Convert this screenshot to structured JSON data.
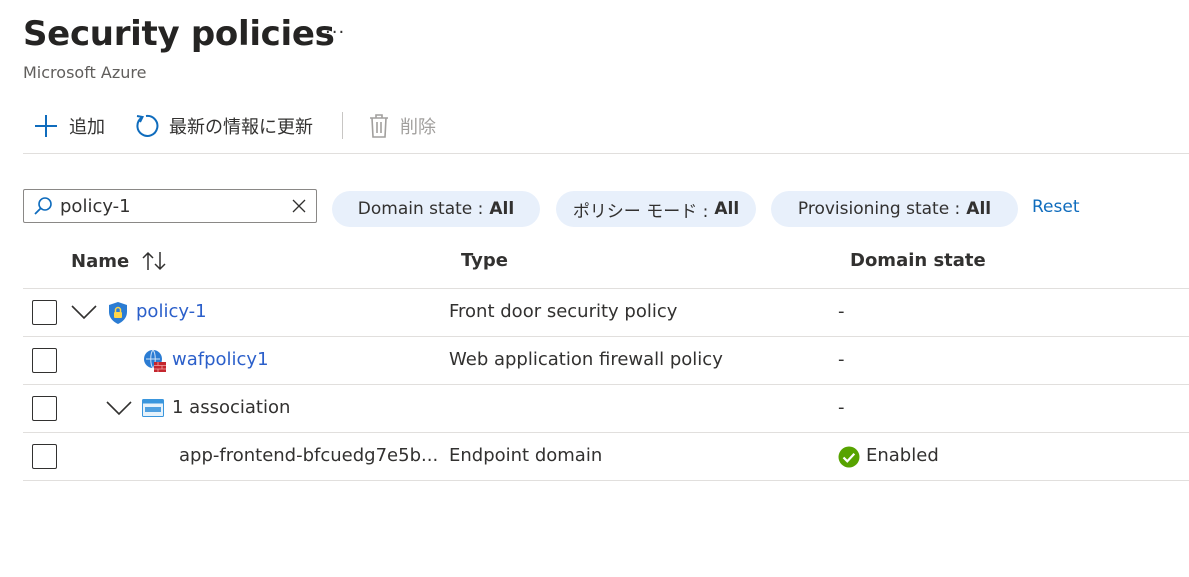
{
  "header": {
    "title": "Security policies",
    "more_label": "···",
    "subtitle": "Microsoft Azure"
  },
  "toolbar": {
    "add_label": "追加",
    "refresh_label": "最新の情報に更新",
    "delete_label": "削除"
  },
  "search": {
    "value": "policy-1"
  },
  "filters": [
    {
      "label": "Domain state :",
      "value": "All"
    },
    {
      "label": "ポリシー モード :",
      "value": "All"
    },
    {
      "label": "Provisioning state :",
      "value": "All"
    }
  ],
  "reset_label": "Reset",
  "table": {
    "columns": [
      "Name",
      "Type",
      "Domain state"
    ],
    "rows": [
      {
        "name": "policy-1",
        "type": "Front door security policy",
        "domain_state": "-",
        "icon": "shield-lock-icon",
        "expandable": true
      },
      {
        "name": "wafpolicy1",
        "type": "Web application firewall policy",
        "domain_state": "-",
        "icon": "waf-globe-icon",
        "expandable": false
      },
      {
        "name": "1 association",
        "type": "",
        "domain_state": "-",
        "icon": "www-domain-icon",
        "expandable": true
      },
      {
        "name": "app-frontend-bfcuedg7e5b...",
        "type": "Endpoint domain",
        "domain_state": "Enabled",
        "icon": "check-circle-icon",
        "expandable": false
      }
    ]
  },
  "colors": {
    "link": "#2b5fca",
    "accent": "#0f6cbd",
    "pill_bg": "#e8f0fb",
    "success": "#57a300"
  }
}
